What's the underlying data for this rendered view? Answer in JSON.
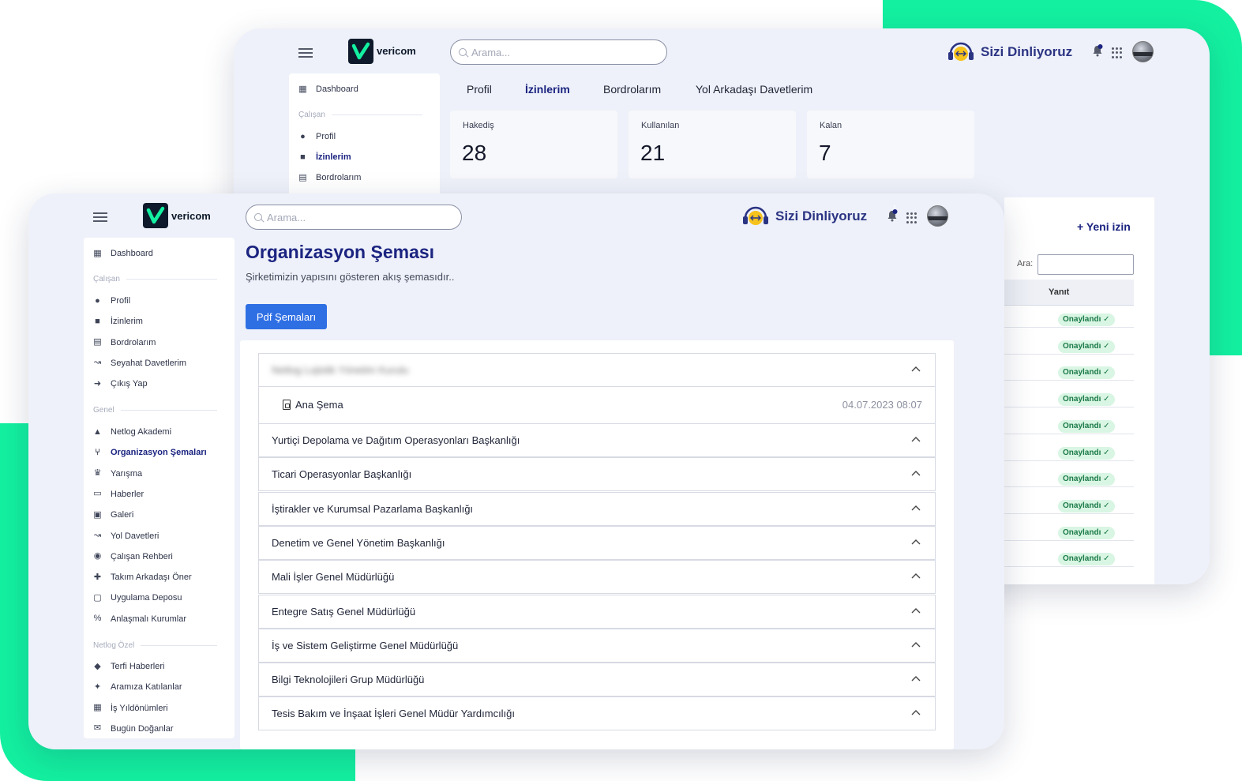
{
  "colors": {
    "accent_green": "#13f0a0",
    "brand_navy": "#1b2480",
    "primary_button": "#2f6fe4",
    "success_pill": "#d9f5e3"
  },
  "back_window": {
    "logo_text": "vericom",
    "search_placeholder": "Arama...",
    "brand_text": "Sizi Dinliyoruz",
    "notification_count": "1",
    "sidebar": {
      "items_top": [
        {
          "label": "Dashboard",
          "icon": "grid-icon"
        }
      ],
      "section_calisan": "Çalışan",
      "items": [
        {
          "label": "Profil",
          "icon": "user-icon"
        },
        {
          "label": "İzinlerim",
          "icon": "suitcase-icon",
          "active": true
        },
        {
          "label": "Bordrolarım",
          "icon": "file-icon"
        }
      ]
    },
    "tabs": [
      {
        "label": "Profil"
      },
      {
        "label": "İzinlerim",
        "active": true
      },
      {
        "label": "Bordrolarım"
      },
      {
        "label": "Yol Arkadaşı Davetlerim"
      }
    ],
    "stats": [
      {
        "label": "Hakediş",
        "value": "28"
      },
      {
        "label": "Kullanılan",
        "value": "21"
      },
      {
        "label": "Kalan",
        "value": "7"
      }
    ],
    "new_button": "+ Yeni izin",
    "search_label": "Ara:",
    "column_header": "Yanıt",
    "status_pills": [
      "Onaylandı ✓",
      "Onaylandı ✓",
      "Onaylandı ✓",
      "Onaylandı ✓",
      "Onaylandı ✓",
      "Onaylandı ✓",
      "Onaylandı ✓",
      "Onaylandı ✓",
      "Onaylandı ✓",
      "Onaylandı ✓"
    ]
  },
  "front_window": {
    "logo_text": "vericom",
    "search_placeholder": "Arama...",
    "brand_text": "Sizi Dinliyoruz",
    "notification_count": "1",
    "sidebar": {
      "dashboard": "Dashboard",
      "section_calisan": "Çalışan",
      "calisan_items": [
        "Profil",
        "İzinlerim",
        "Bordrolarım",
        "Seyahat Davetlerim",
        "Çıkış Yap"
      ],
      "section_genel": "Genel",
      "genel_items": [
        "Netlog Akademi",
        "Organizasyon Şemaları",
        "Yarışma",
        "Haberler",
        "Galeri",
        "Yol Davetleri",
        "Çalışan Rehberi",
        "Takım Arkadaşı Öner",
        "Uygulama Deposu",
        "Anlaşmalı Kurumlar"
      ],
      "section_ozel": "Netlog Özel",
      "ozel_items": [
        "Terfi Haberleri",
        "Aramıza Katılanlar",
        "İş Yıldönümleri",
        "Bugün Doğanlar"
      ]
    },
    "page_title": "Organizasyon Şeması",
    "page_subtitle": "Şirketimizin yapısını gösteren akış şemasıdır..",
    "pdf_button": "Pdf Şemaları",
    "first_group": "Netlog Lojistik Yönetim Kurulu",
    "document": {
      "name": "Ana Şema",
      "date": "04.07.2023 08:07"
    },
    "groups": [
      "Yurtiçi Depolama ve Dağıtım Operasyonları Başkanlığı",
      "Ticari Operasyonlar Başkanlığı",
      "İştirakler ve Kurumsal Pazarlama Başkanlığı",
      "Denetim ve Genel Yönetim Başkanlığı",
      "Mali İşler Genel Müdürlüğü",
      "Entegre Satış Genel Müdürlüğü",
      "İş ve Sistem Geliştirme Genel Müdürlüğü",
      "Bilgi Teknolojileri Grup Müdürlüğü",
      "Tesis Bakım ve İnşaat İşleri Genel Müdür Yardımcılığı"
    ]
  }
}
